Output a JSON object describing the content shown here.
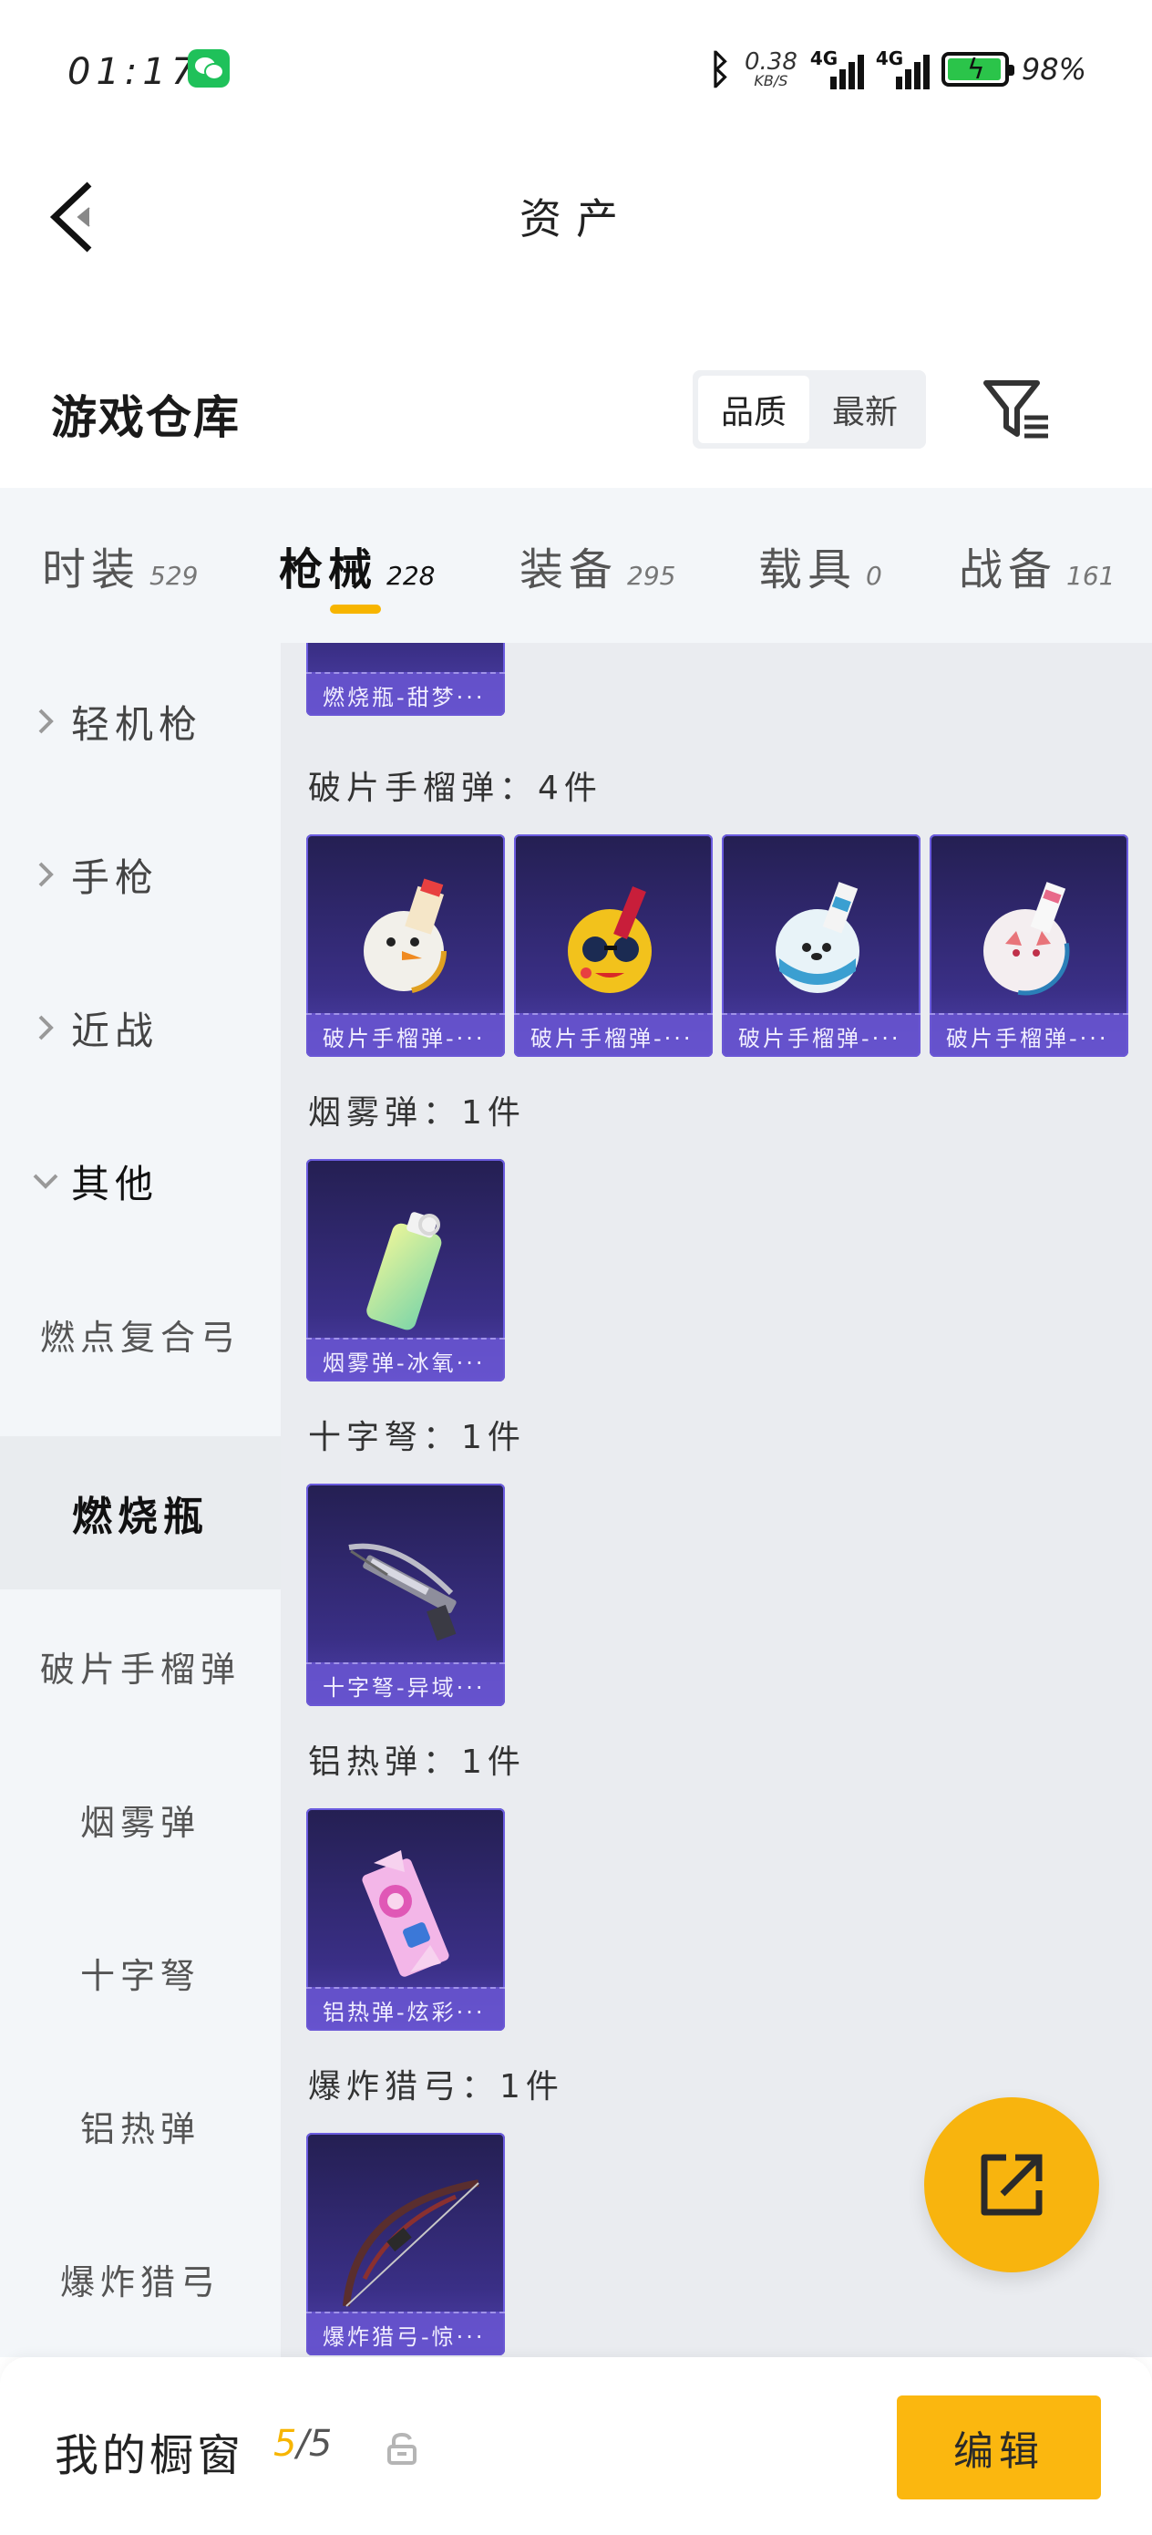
{
  "status_bar": {
    "time": "01:17",
    "net_speed_value": "0.38",
    "net_speed_unit": "KB/S",
    "signal1_label": "4G",
    "signal2_label": "4G",
    "battery": "98%"
  },
  "nav": {
    "title": "资产"
  },
  "header": {
    "title": "游戏仓库",
    "sort_options": [
      "品质",
      "最新"
    ],
    "active_sort": "品质"
  },
  "tabs": [
    {
      "name": "时装",
      "count": "529"
    },
    {
      "name": "枪械",
      "count": "228"
    },
    {
      "name": "装备",
      "count": "295"
    },
    {
      "name": "载具",
      "count": "0"
    },
    {
      "name": "战备",
      "count": "161"
    }
  ],
  "active_tab": "枪械",
  "sidebar": {
    "groups": [
      "轻机枪",
      "手枪",
      "近战",
      "其他"
    ],
    "sub_items": [
      "燃点复合弓",
      "燃烧瓶",
      "破片手榴弹",
      "烟雾弹",
      "十字弩",
      "铝热弹",
      "爆炸猎弓"
    ],
    "selected": "燃烧瓶"
  },
  "content": {
    "top_partial_card": "燃烧瓶-甜梦···",
    "groups": [
      {
        "label": "破片手榴弹：4件",
        "items": [
          "破片手榴弹-···",
          "破片手榴弹-···",
          "破片手榴弹-···",
          "破片手榴弹-···"
        ]
      },
      {
        "label": "烟雾弹：1件",
        "items": [
          "烟雾弹-冰氧···"
        ]
      },
      {
        "label": "十字弩：1件",
        "items": [
          "十字弩-异域···"
        ]
      },
      {
        "label": "铝热弹：1件",
        "items": [
          "铝热弹-炫彩···"
        ]
      },
      {
        "label": "爆炸猎弓：1件",
        "items": [
          "爆炸猎弓-惊···"
        ]
      }
    ]
  },
  "bottom_bar": {
    "title": "我的橱窗",
    "current": "5",
    "total": "/5",
    "edit_label": "编辑"
  },
  "colors": {
    "accent": "#f7b500",
    "card_bg": "#3a2f86",
    "sidebar_bg": "#f3f6f9",
    "content_bg": "#eaecf0"
  }
}
